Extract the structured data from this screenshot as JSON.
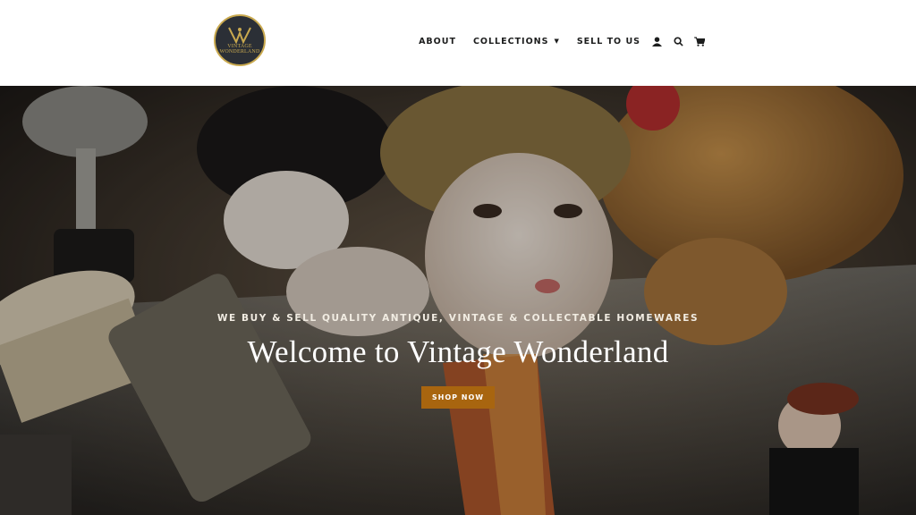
{
  "brand": {
    "logo_line1": "VINTAGE",
    "logo_line2": "WONDERLAND",
    "logo_monogram": "VW"
  },
  "nav": {
    "items": [
      {
        "label": "ABOUT"
      },
      {
        "label": "COLLECTIONS"
      },
      {
        "label": "SELL TO US"
      }
    ],
    "icons": [
      "account-icon",
      "search-icon",
      "cart-icon"
    ]
  },
  "hero": {
    "subtitle": "WE BUY & SELL QUALITY ANTIQUE, VINTAGE & COLLECTABLE HOMEWARES",
    "title": "Welcome to Vintage Wonderland",
    "button_label": "SHOP NOW",
    "image_subject": "antique doll, teddy bear, brush and grater on glass shelf"
  },
  "colors": {
    "accent": "#a8650f",
    "logo_bg": "#2b2f36",
    "logo_gold": "#c9a94f",
    "nav_text": "#1c1d1d"
  }
}
